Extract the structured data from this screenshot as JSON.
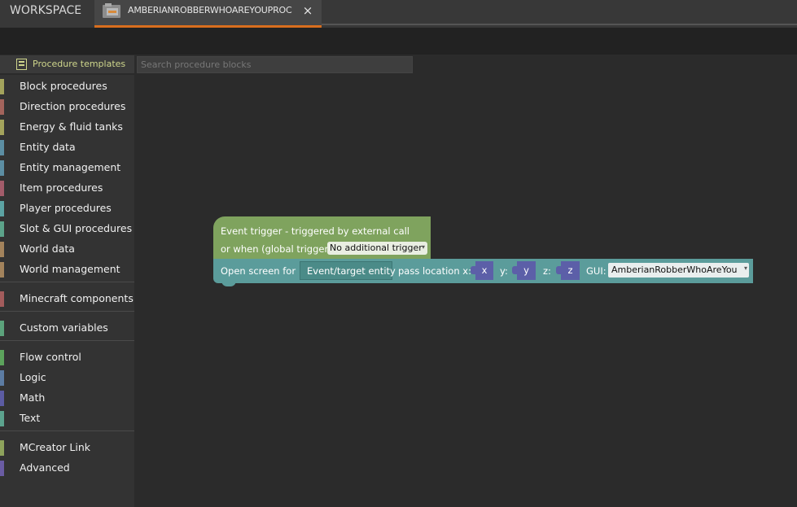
{
  "tabs": {
    "workspace": "WORKSPACE",
    "active": "AMBERIANROBBERWHOAREYOUPROC",
    "close_glyph": "×"
  },
  "toolbar": {
    "templates_label": "Procedure templates",
    "search_placeholder": "Search procedure blocks"
  },
  "sidebar": {
    "groups": [
      [
        {
          "label": "Block procedures",
          "color": "#a3a35c"
        },
        {
          "label": "Direction procedures",
          "color": "#a3645c"
        },
        {
          "label": "Energy & fluid tanks",
          "color": "#a3a35c"
        },
        {
          "label": "Entity data",
          "color": "#5c8ea3"
        },
        {
          "label": "Entity management",
          "color": "#5c8ea3"
        },
        {
          "label": "Item procedures",
          "color": "#a35c6a"
        },
        {
          "label": "Player procedures",
          "color": "#5ca3a3"
        },
        {
          "label": "Slot & GUI procedures",
          "color": "#5ca38a"
        },
        {
          "label": "World data",
          "color": "#a3835c"
        },
        {
          "label": "World management",
          "color": "#a3835c"
        }
      ],
      [
        {
          "label": "Minecraft components",
          "color": "#a35c5c"
        }
      ],
      [
        {
          "label": "Custom variables",
          "color": "#5ca37c"
        }
      ],
      [
        {
          "label": "Flow control",
          "color": "#5ca35c"
        },
        {
          "label": "Logic",
          "color": "#5c7ca3"
        },
        {
          "label": "Math",
          "color": "#5c5ca3"
        },
        {
          "label": "Text",
          "color": "#5ca38e"
        }
      ],
      [
        {
          "label": "MCreator Link",
          "color": "#8ea35c"
        },
        {
          "label": "Advanced",
          "color": "#6a5ca3"
        }
      ]
    ]
  },
  "blocks": {
    "event": {
      "line1": "Event trigger - triggered by external call",
      "line2": "or when (global trigger):",
      "trigger_value": "No additional trigger",
      "color": "#7fa35e"
    },
    "action": {
      "open_screen": "Open screen for",
      "entity": "Event/target entity",
      "pass_location": "pass location x:",
      "x": "x",
      "y_label": "y:",
      "y": "y",
      "z_label": "z:",
      "z": "z",
      "gui_label": "GUI:",
      "gui_value": "AmberianRobberWhoAreYou",
      "color": "#5b9c9b"
    }
  },
  "icons": {
    "tab": "folder-icon",
    "templates": "template-icon",
    "dropdown": "dropdown-arrow-icon"
  },
  "colors": {
    "accent": "#d86e1e",
    "background": "#2b2b2b"
  }
}
